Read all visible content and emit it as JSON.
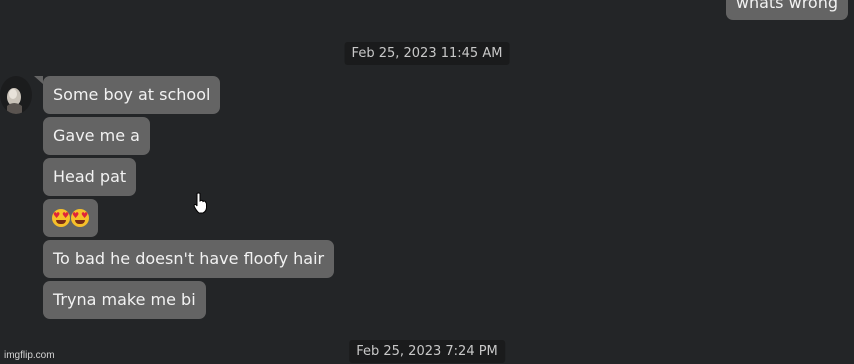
{
  "chat": {
    "outgoing": [
      {
        "text": "whats wrong"
      }
    ],
    "timestamps": [
      "Feb 25, 2023 11:45 AM",
      "Feb 25, 2023 7:24 PM"
    ],
    "incoming": [
      {
        "text": "Some boy at school"
      },
      {
        "text": "Gave me a"
      },
      {
        "text": "Head pat"
      },
      {
        "emoji": "smiling-face-with-heart-eyes x2"
      },
      {
        "text": "To bad he doesn't have floofy hair"
      },
      {
        "text": "Tryna make me bi"
      }
    ]
  },
  "watermark": "imgflip.com",
  "colors": {
    "background": "#232527",
    "bubble": "#646464",
    "timestamp_bg": "#1a1b1c",
    "text": "#f2f2f2"
  }
}
